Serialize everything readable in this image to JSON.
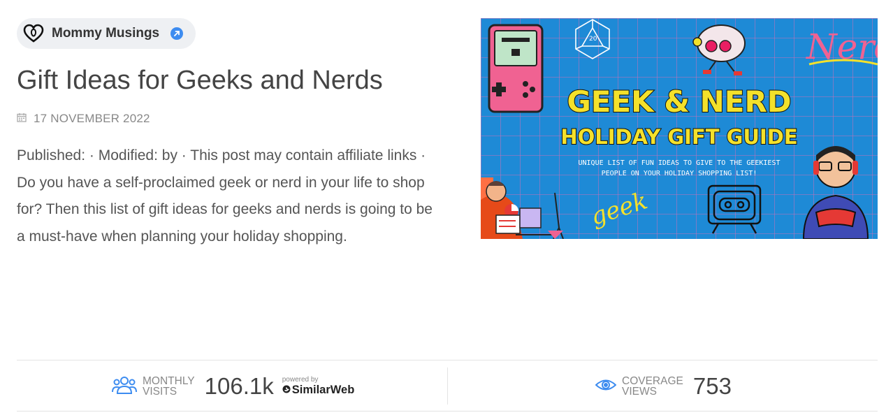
{
  "source": {
    "name": "Mommy Musings",
    "icon": "heart-logo-icon",
    "link_icon": "external-arrow-icon",
    "accent": "#3d8cf0"
  },
  "article": {
    "title": "Gift Ideas for Geeks and Nerds",
    "date": "17 NOVEMBER 2022",
    "excerpt": "Published: · Modified: by · This post may contain affiliate links · Do you have a self-proclaimed geek or nerd in your life to shop for? Then this list of gift ideas for geeks and nerds is going to be a must-have when planning your holiday shopping."
  },
  "hero": {
    "background": "#1e8ad6",
    "headline": "GEEK & NERD",
    "subheadline": "HOLIDAY GIFT GUIDE",
    "tagline_line1": "UNIQUE LIST OF FUN IDEAS TO GIVE TO THE GEEKIEST",
    "tagline_line2": "PEOPLE ON YOUR HOLIDAY SHOPPING LIST!",
    "nerd_word": "Nerd",
    "geek_word": "geek",
    "dice_number": "20"
  },
  "stats": {
    "visits": {
      "label_line1": "MONTHLY",
      "label_line2": "VISITS",
      "value": "106.1k",
      "powered_by": "powered by",
      "provider": "SimilarWeb",
      "icon": "users-icon"
    },
    "coverage": {
      "label_line1": "COVERAGE",
      "label_line2": "VIEWS",
      "value": "753",
      "icon": "eye-icon"
    }
  }
}
